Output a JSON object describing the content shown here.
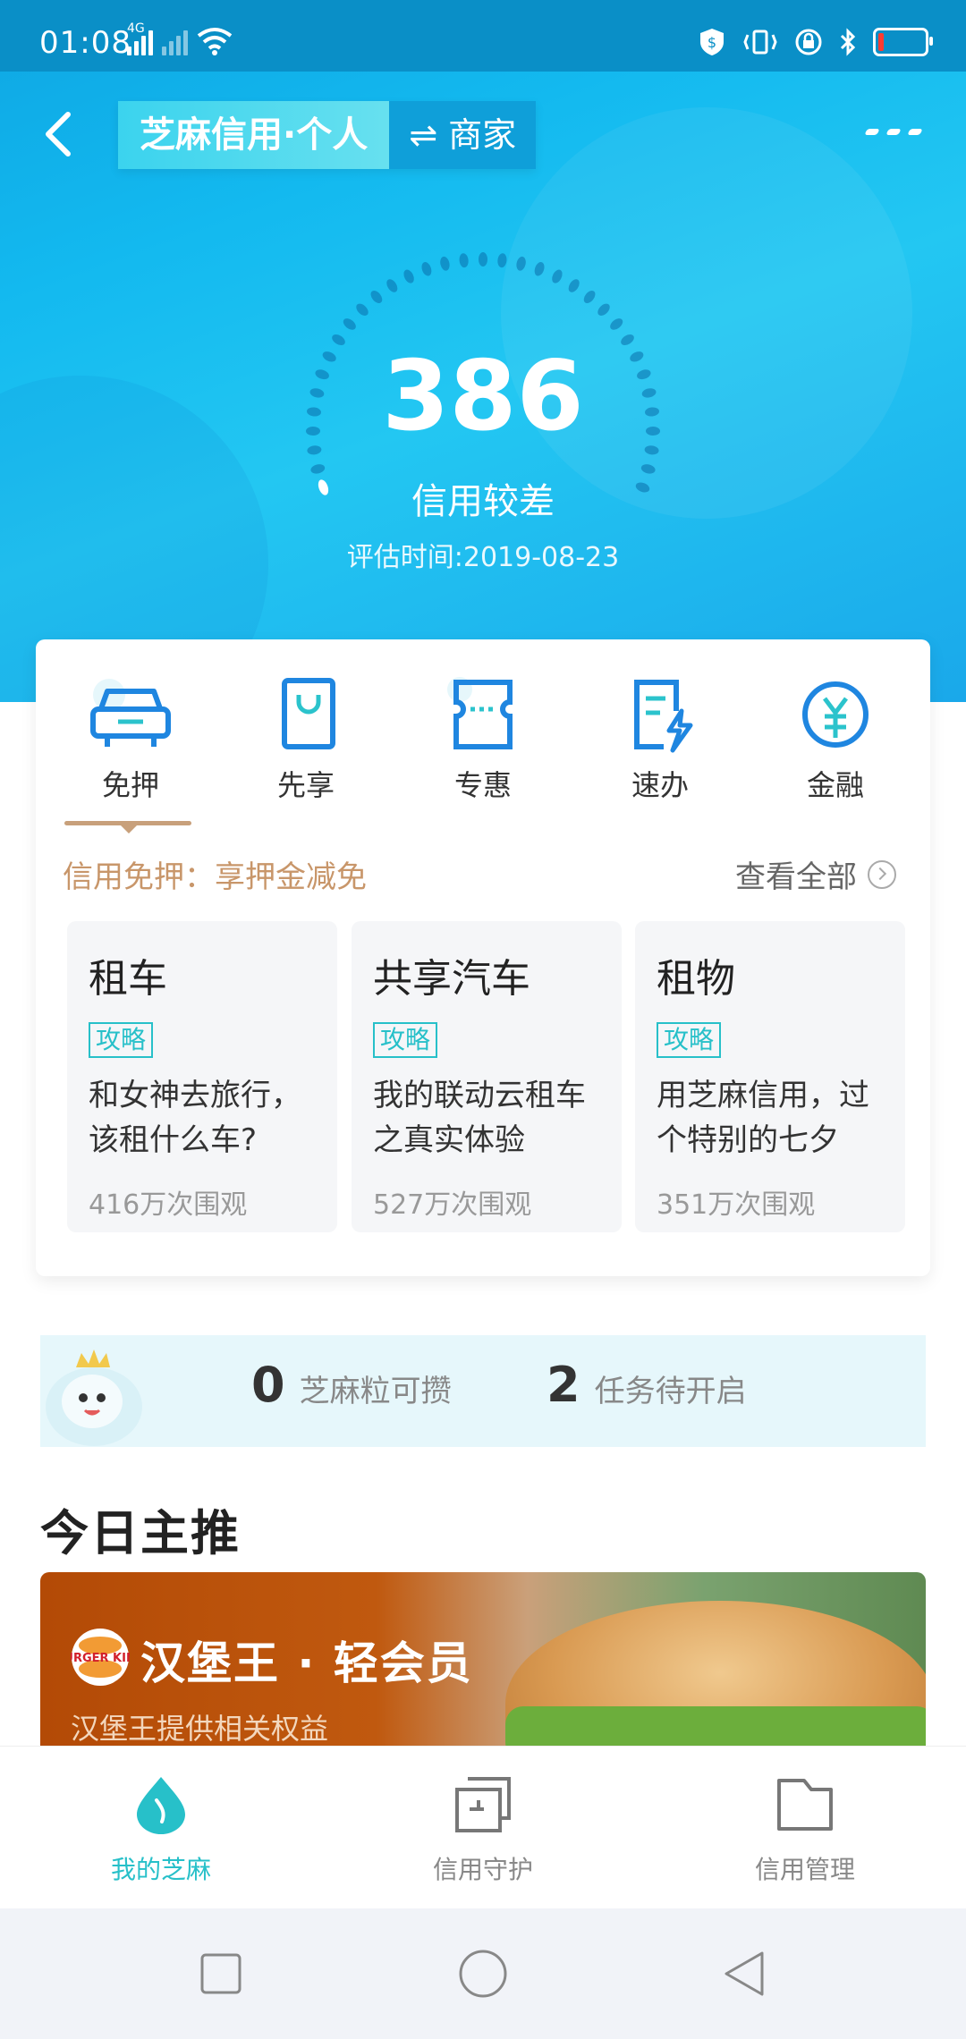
{
  "status_bar": {
    "time": "01:08",
    "network_label": "4G"
  },
  "header": {
    "title_personal": "芝麻信用·个人",
    "title_merchant": "⇌ 商家"
  },
  "score": {
    "value": "386",
    "level": "信用较差",
    "eval_date": "评估时间:2019-08-23"
  },
  "tabs": [
    {
      "label": "免押",
      "icon": "car-icon"
    },
    {
      "label": "先享",
      "icon": "shopping-bag-icon"
    },
    {
      "label": "专惠",
      "icon": "coupon-icon"
    },
    {
      "label": "速办",
      "icon": "fast-doc-icon"
    },
    {
      "label": "金融",
      "icon": "yuan-icon"
    }
  ],
  "promo": {
    "title": "信用免押：享押金减免",
    "view_all": "查看全部"
  },
  "cards": [
    {
      "title": "租车",
      "tag": "攻略",
      "desc": "和女神去旅行，该租什么车?",
      "views": "416万次围观"
    },
    {
      "title": "共享汽车",
      "tag": "攻略",
      "desc": "我的联动云租车之真实体验",
      "views": "527万次围观"
    },
    {
      "title": "租物",
      "tag": "攻略",
      "desc": "用芝麻信用，过个特别的七夕",
      "views": "351万次围观"
    }
  ],
  "sesame": {
    "grains_count": "0",
    "grains_label": "芝麻粒可攒",
    "tasks_count": "2",
    "tasks_label": "任务待开启"
  },
  "today": {
    "title": "今日主推",
    "banner_title": "汉堡王 · 轻会员",
    "banner_sub": "汉堡王提供相关权益",
    "logo_text": "BURGER KING"
  },
  "bottom_nav": [
    {
      "label": "我的芝麻",
      "icon": "sesame-drop-icon",
      "active": true
    },
    {
      "label": "信用守护",
      "icon": "shield-cards-icon",
      "active": false
    },
    {
      "label": "信用管理",
      "icon": "folder-icon",
      "active": false
    }
  ],
  "colors": {
    "accent": "#27c0c9",
    "hero": "#13b9ef",
    "promo_gold": "#c8966a"
  }
}
